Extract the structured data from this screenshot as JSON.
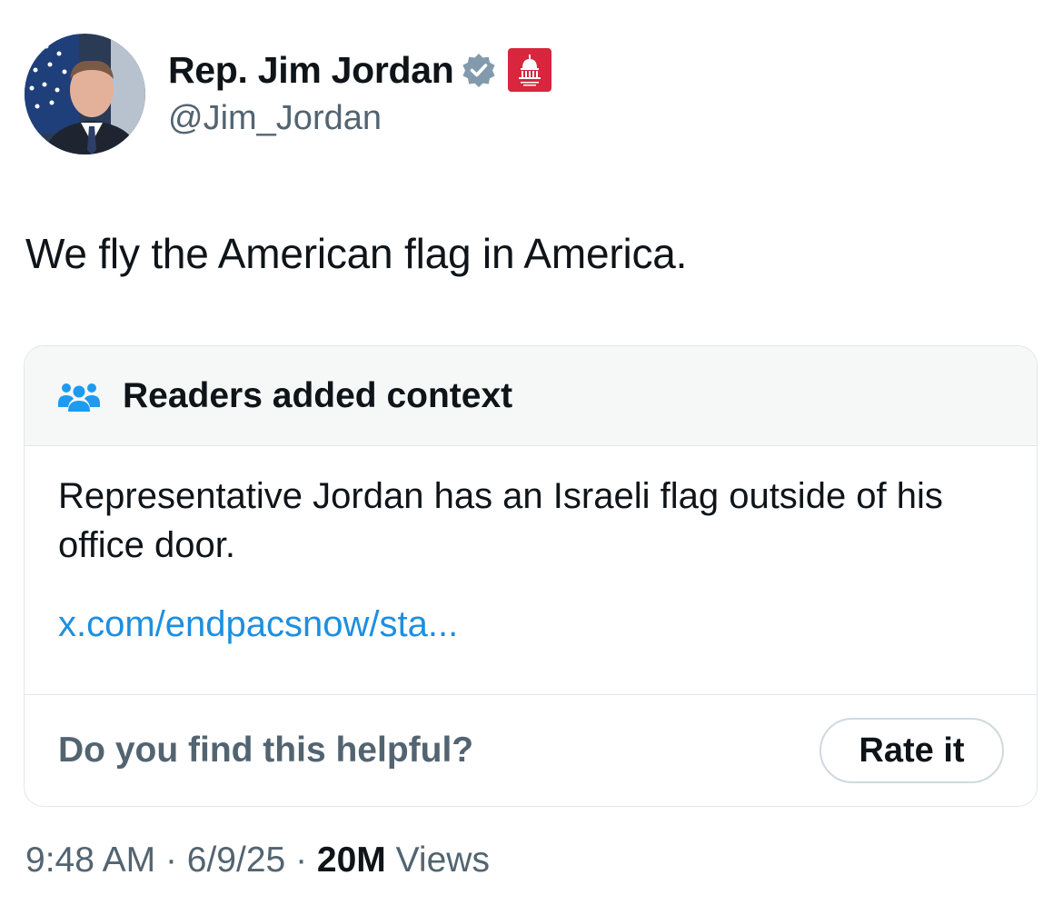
{
  "author": {
    "display_name": "Rep. Jim Jordan",
    "handle": "@Jim_Jordan",
    "verified_badge_icon": "verified-badge-icon",
    "affiliate_badge_icon": "house-gop-capitol-icon",
    "affiliate_badge_color": "#d7263d",
    "verified_badge_color": "#829aab"
  },
  "tweet": {
    "text": "We fly the American flag in America."
  },
  "community_note": {
    "header_icon": "people-group-icon",
    "title": "Readers added context",
    "body": "Representative Jordan has an Israeli flag outside of his office door.",
    "link_text": "x.com/endpacsnow/sta...",
    "helpful_question": "Do you find this helpful?",
    "rate_button_label": "Rate it",
    "accent_color": "#1d9bf0"
  },
  "meta": {
    "time": "9:48 AM",
    "separator": "·",
    "date": "6/9/25",
    "views_count": "20M",
    "views_label": "Views"
  }
}
